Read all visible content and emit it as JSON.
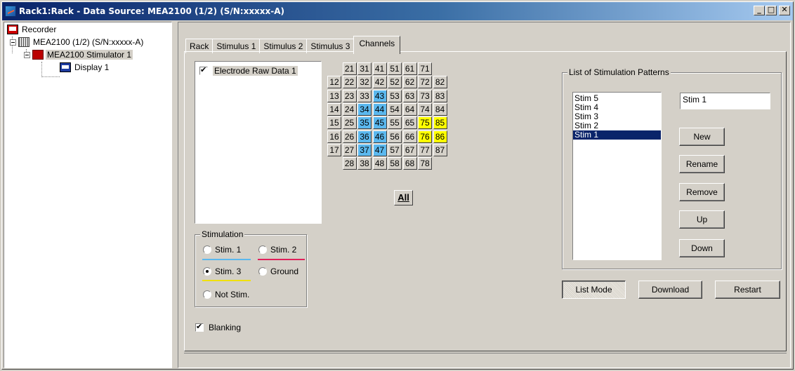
{
  "window": {
    "title": "Rack1:Rack - Data Source: MEA2100 (1/2) (S/N:xxxxx-A)",
    "buttons": [
      "_",
      "□",
      "✕"
    ]
  },
  "tree": {
    "items": [
      {
        "label": "Recorder",
        "icon": "recorder-icon"
      },
      {
        "label": "MEA2100 (1/2) (S/N:xxxxx-A)",
        "icon": "device-grid-icon"
      },
      {
        "label": "MEA2100 Stimulator 1",
        "icon": "stimulator-icon"
      },
      {
        "label": "Display 1",
        "icon": "display-icon"
      }
    ]
  },
  "tabs": [
    "Rack",
    "Stimulus 1",
    "Stimulus 2",
    "Stimulus 3",
    "Channels"
  ],
  "active_tab": "Channels",
  "channels": {
    "stream_item": "Electrode Raw Data 1",
    "stream_checked": true,
    "grid_rows": [
      [
        "",
        "21",
        "31",
        "41",
        "51",
        "61",
        "71",
        ""
      ],
      [
        "12",
        "22",
        "32",
        "42",
        "52",
        "62",
        "72",
        "82"
      ],
      [
        "13",
        "23",
        "33",
        "43",
        "53",
        "63",
        "73",
        "83"
      ],
      [
        "14",
        "24",
        "34",
        "44",
        "54",
        "64",
        "74",
        "84"
      ],
      [
        "15",
        "25",
        "35",
        "45",
        "55",
        "65",
        "75",
        "85"
      ],
      [
        "16",
        "26",
        "36",
        "46",
        "56",
        "66",
        "76",
        "86"
      ],
      [
        "17",
        "27",
        "37",
        "47",
        "57",
        "67",
        "77",
        "87"
      ],
      [
        "",
        "28",
        "38",
        "48",
        "58",
        "68",
        "78",
        ""
      ]
    ],
    "stim1_electrodes": [
      "43",
      "34",
      "44",
      "35",
      "45",
      "36",
      "46",
      "37",
      "47"
    ],
    "stim3_electrodes": [
      "75",
      "85",
      "76",
      "86"
    ],
    "all_button": "All"
  },
  "stimulation": {
    "title": "Stimulation",
    "options": [
      {
        "label": "Stim. 1",
        "color": "#5bb8ee",
        "selected": false
      },
      {
        "label": "Stim. 2",
        "color": "#e0205a",
        "selected": false
      },
      {
        "label": "Stim. 3",
        "color": "#f0e000",
        "selected": true
      },
      {
        "label": "Ground",
        "color": "",
        "selected": false
      },
      {
        "label": "Not Stim.",
        "color": "",
        "selected": false
      }
    ]
  },
  "blanking": {
    "label": "Blanking",
    "checked": true
  },
  "patterns": {
    "title": "List of Stimulation Patterns",
    "items": [
      "Stim 5",
      "Stim 4",
      "Stim 3",
      "Stim 2",
      "Stim 1"
    ],
    "selected": "Stim 1",
    "name_value": "Stim 1",
    "buttons": {
      "new": "New",
      "rename": "Rename",
      "remove": "Remove",
      "up": "Up",
      "down": "Down"
    }
  },
  "footer_buttons": {
    "list_mode": "List Mode",
    "download": "Download",
    "restart": "Restart"
  }
}
